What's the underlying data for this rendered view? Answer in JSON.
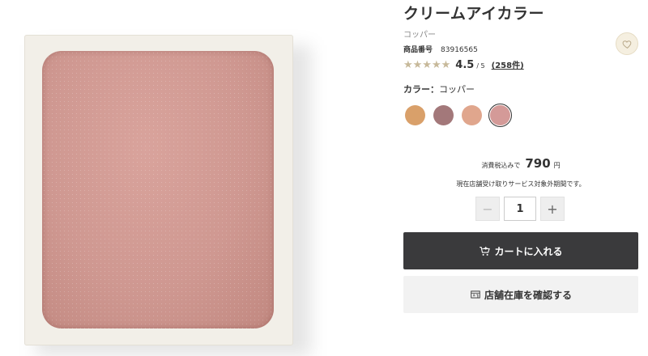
{
  "product": {
    "title": "クリームアイカラー",
    "color_name": "コッパー",
    "sku_label": "商品番号",
    "sku_value": "83916565",
    "rating": {
      "stars_display": "★★★★★",
      "score": "4.5",
      "out_of": "/ 5",
      "review_count": "(258件)",
      "value": 4.5
    }
  },
  "color_selector": {
    "label": "カラー：",
    "selected_value": "コッパー",
    "swatches": [
      {
        "name": "orange-beige",
        "color": "#d9a06a",
        "selected": false
      },
      {
        "name": "mauve",
        "color": "#a3787a",
        "selected": false
      },
      {
        "name": "peach",
        "color": "#e0a68d",
        "selected": false
      },
      {
        "name": "copper",
        "color": "#d49a98",
        "selected": true
      }
    ]
  },
  "price": {
    "tax_label": "消費税込みで",
    "amount": "790",
    "currency": "円"
  },
  "pickup_note": "現在店舗受け取りサービス対象外期間です。",
  "quantity": {
    "minus": "−",
    "value": "1",
    "plus": "+"
  },
  "buttons": {
    "add_to_cart": "カートに入れる",
    "check_store_stock": "店舗在庫を確認する"
  },
  "colors": {
    "primary_button_bg": "#3a3a3c",
    "secondary_button_bg": "#f2f2f2",
    "star_color": "#c7b99a",
    "pan_color": "#cf9891"
  }
}
